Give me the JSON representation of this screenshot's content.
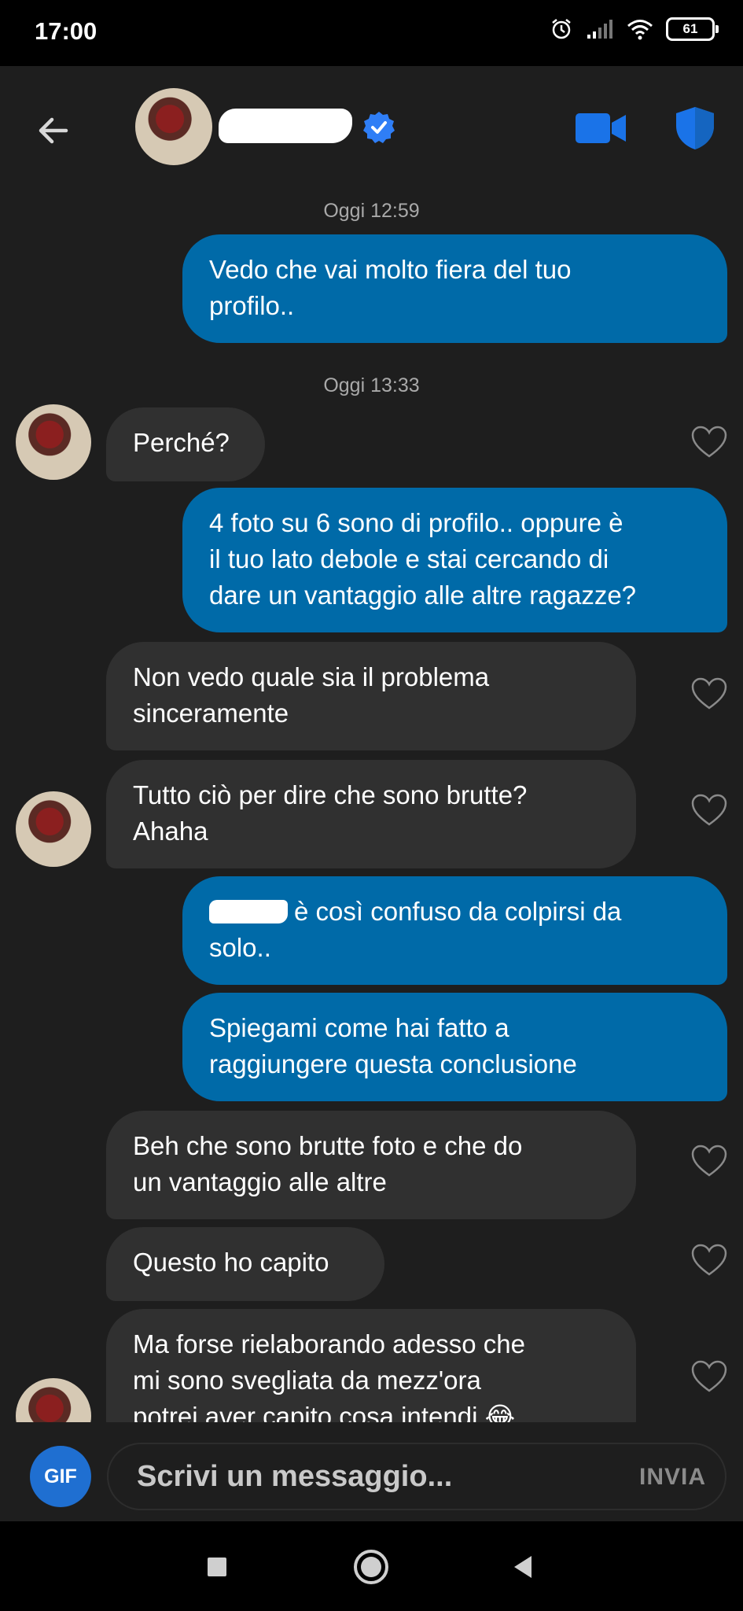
{
  "status_bar": {
    "time": "17:00",
    "battery": "61"
  },
  "header": {
    "contact_name": "",
    "icons": [
      "back-arrow-icon",
      "verified-badge-icon",
      "video-call-icon",
      "shield-icon"
    ]
  },
  "messages": {
    "ts1": "Oggi 12:59",
    "m1": "Vedo che vai molto fiera del tuo\nprofilo..",
    "ts2": "Oggi 13:33",
    "m2": "Perché?",
    "m3": "4 foto su 6 sono di profilo.. oppure è\nil tuo lato debole e stai cercando di\ndare un vantaggio alle altre ragazze?",
    "m4": "Non vedo quale sia il problema\nsinceramente",
    "m5": "Tutto ciò per dire che sono brutte?\nAhaha",
    "m6": "è così confuso da colpirsi da\nsolo..",
    "m7": "Spiegami come hai fatto a\nraggiungere questa conclusione",
    "m8": "Beh che sono brutte foto e che do\nun vantaggio alle altre",
    "m9": "Questo ho capito",
    "m10": "Ma forse rielaborando adesso che\nmi sono svegliata da mezz'ora\npotrei aver capito cosa intendi 😂"
  },
  "composer": {
    "gif_label": "GIF",
    "placeholder": "Scrivi un messaggio...",
    "send_label": "INVIA"
  },
  "colors": {
    "outgoing_bubble": "#006aa8",
    "incoming_bubble": "#303030",
    "background": "#1e1e1e",
    "accent": "#1f6fd1"
  }
}
